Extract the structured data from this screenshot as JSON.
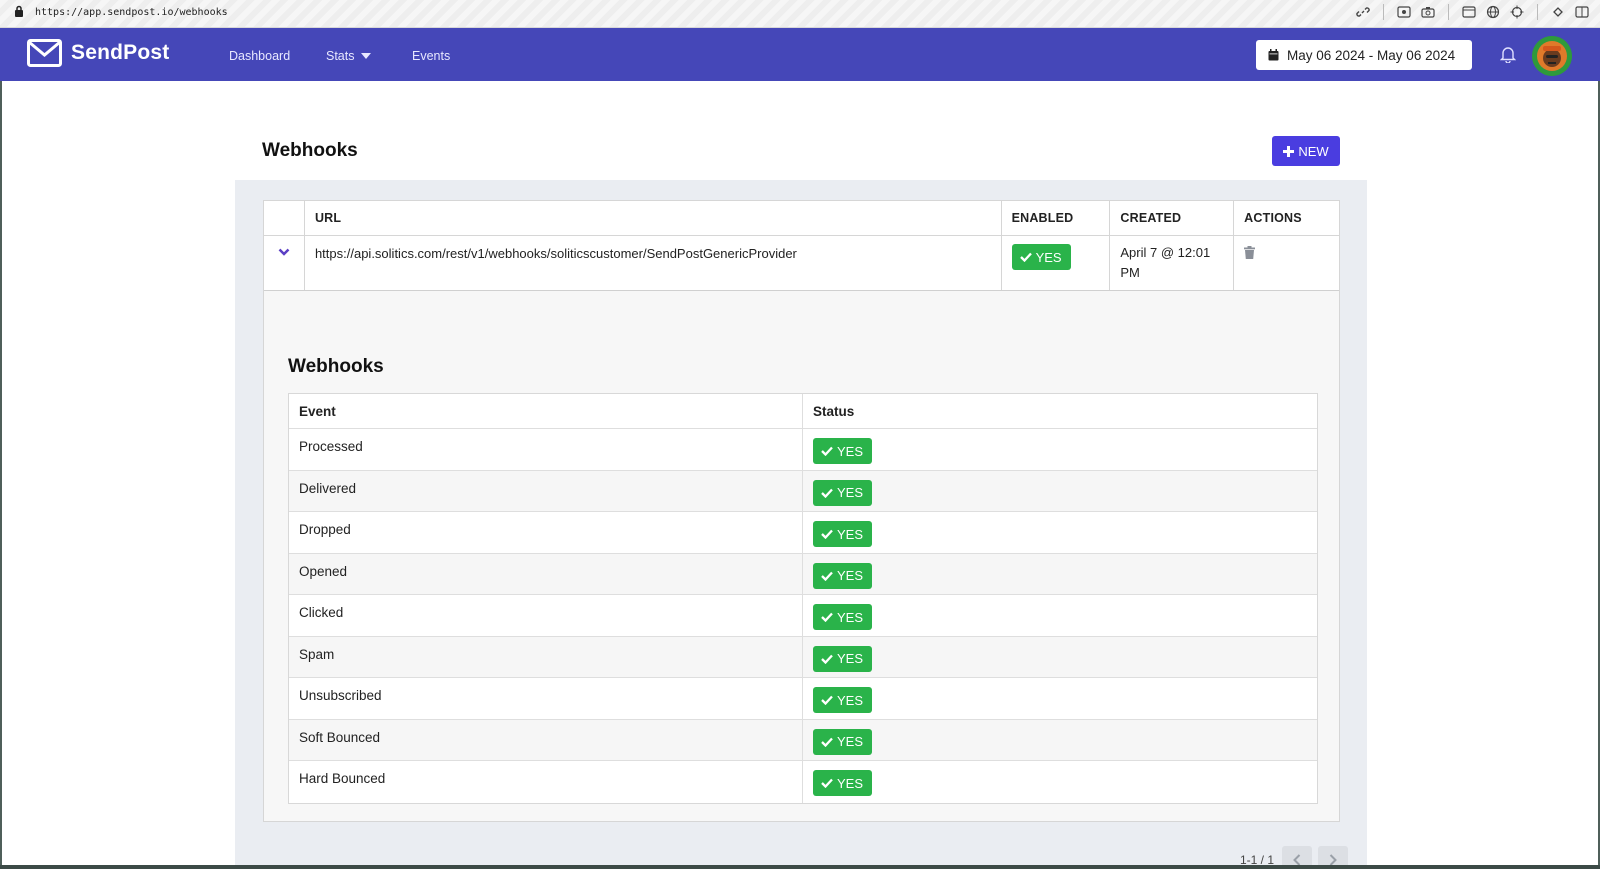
{
  "browser": {
    "url": "https://app.sendpost.io/webhooks"
  },
  "nav": {
    "brand": "SendPost",
    "links": {
      "dashboard": "Dashboard",
      "stats": "Stats",
      "events": "Events"
    },
    "date_range": "May 06 2024 - May 06 2024"
  },
  "page": {
    "title": "Webhooks",
    "new_label": "NEW"
  },
  "table": {
    "headers": {
      "url": "URL",
      "enabled": "ENABLED",
      "created": "CREATED",
      "actions": "ACTIONS"
    },
    "row": {
      "url": "https://api.solitics.com/rest/v1/webhooks/soliticscustomer/SendPostGenericProvider",
      "enabled": "YES",
      "created": "April 7 @ 12:01 PM"
    }
  },
  "details": {
    "title": "Webhooks",
    "headers": {
      "event": "Event",
      "status": "Status"
    },
    "events": [
      {
        "event": "Processed",
        "status": "YES"
      },
      {
        "event": "Delivered",
        "status": "YES"
      },
      {
        "event": "Dropped",
        "status": "YES"
      },
      {
        "event": "Opened",
        "status": "YES"
      },
      {
        "event": "Clicked",
        "status": "YES"
      },
      {
        "event": "Spam",
        "status": "YES"
      },
      {
        "event": "Unsubscribed",
        "status": "YES"
      },
      {
        "event": "Soft Bounced",
        "status": "YES"
      },
      {
        "event": "Hard Bounced",
        "status": "YES"
      }
    ]
  },
  "pagination": {
    "text": "1-1 / 1"
  },
  "colors": {
    "nav": "#4547b8",
    "primary_button": "#4a3de0",
    "success": "#2ab34a",
    "accent_chevron": "#5b3fc4"
  }
}
